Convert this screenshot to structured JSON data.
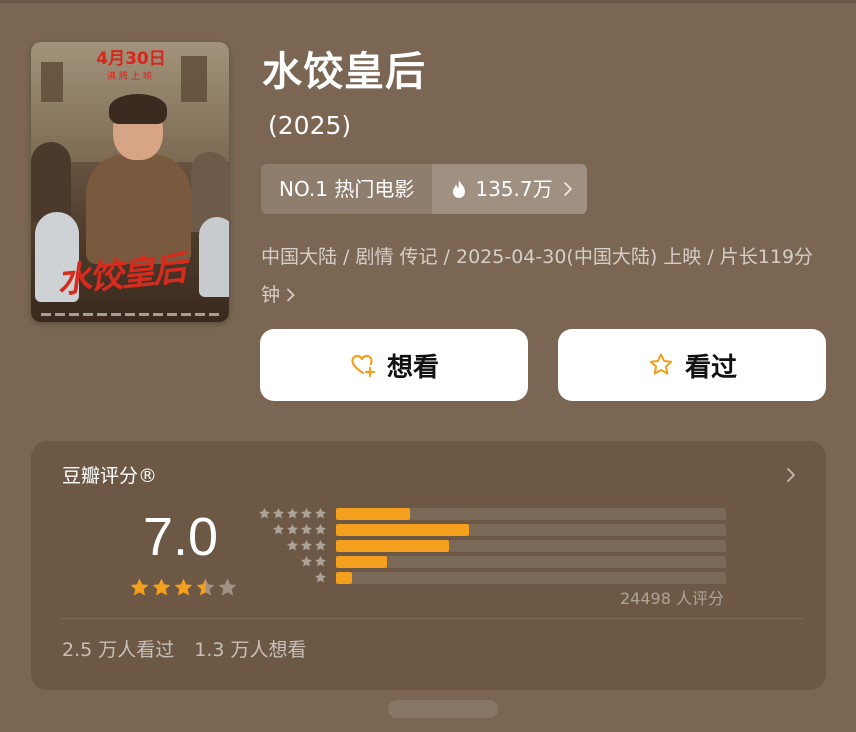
{
  "movie": {
    "title": "水饺皇后",
    "year": "(2025)",
    "poster": {
      "date_text": "4月30日",
      "date_sub": "沸腾上映",
      "calligraphy": "水饺皇后"
    },
    "rank_label": "NO.1 热门电影",
    "heat_value": "135.7万",
    "meta_line": "中国大陆 / 剧情 传记 / 2025-04-30(中国大陆) 上映 / 片长119分钟",
    "buttons": {
      "want_label": "想看",
      "seen_label": "看过"
    }
  },
  "rating": {
    "header": "豆瓣评分®",
    "score": "7.0",
    "stars": 3.5,
    "distribution": [
      {
        "stars": 5,
        "fraction": 0.19
      },
      {
        "stars": 4,
        "fraction": 0.34
      },
      {
        "stars": 3,
        "fraction": 0.29
      },
      {
        "stars": 2,
        "fraction": 0.13
      },
      {
        "stars": 1,
        "fraction": 0.04
      }
    ],
    "count_text": "24498 人评分",
    "watched_text": "2.5 万人看过",
    "want_text": "1.3 万人想看"
  },
  "colors": {
    "background": "#7a6652",
    "accent_orange": "#f5a01c",
    "poster_red": "#d8261c"
  },
  "icons": {
    "heart_plus": "heart-plus-icon",
    "star": "star-icon",
    "flame": "flame-icon",
    "chevron": "chevron-right-icon"
  }
}
